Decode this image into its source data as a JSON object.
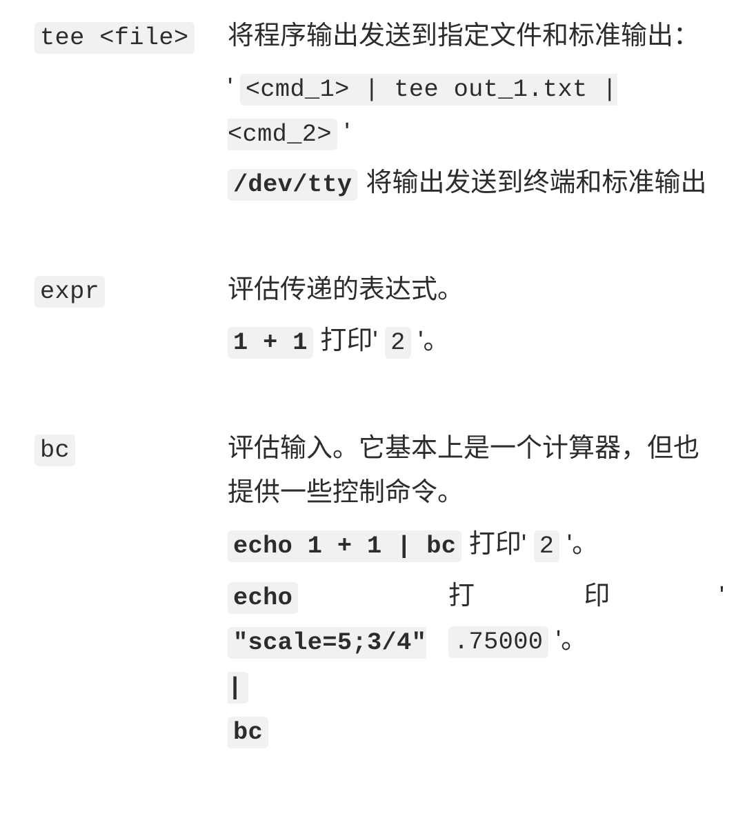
{
  "entries": [
    {
      "term_code": "tee <file>",
      "desc1": "将程序输出发送到指定文件和标准输出：",
      "q1": "'",
      "example_code": "<cmd_1> | tee out_1.txt | <cmd_2>",
      "q2": "'",
      "sub_term_code": "/dev/tty",
      "sub_desc": "将输出发送到终端和标准输出"
    },
    {
      "term_code": "expr",
      "desc1": "评估传递的表达式。",
      "ex_code": "1 + 1",
      "ex_mid": "打印'",
      "ex_val": "2",
      "ex_tail": "'。"
    },
    {
      "term_code": "bc",
      "desc1": "评估输入。它基本上是一个计算器，但也提供一些控制命令。",
      "l1_code": "echo 1 + 1 | bc",
      "l1_mid": "打印'",
      "l1_val": "2",
      "l1_tail": "'。",
      "l2_code_a": "echo",
      "l2_code_b": "\"scale=5;3/4\" |",
      "l2_code_c": "bc",
      "l2_mid_a": "打",
      "l2_mid_b": "印",
      "l2_mid_q": "'",
      "l2_val": ".75000",
      "l2_tail": "'。"
    }
  ]
}
